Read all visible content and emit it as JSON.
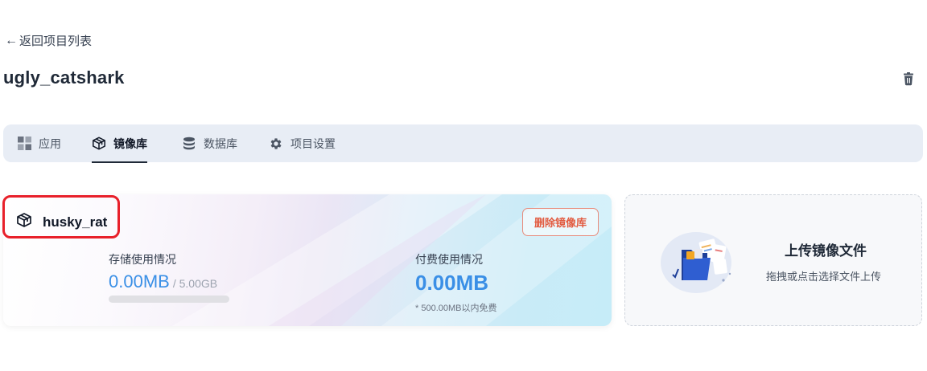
{
  "nav": {
    "back_label": "返回项目列表",
    "back_icon": "arrow-left-icon"
  },
  "project": {
    "title": "ugly_catshark",
    "delete_icon": "trash-icon"
  },
  "tabs": [
    {
      "label": "应用",
      "icon": "grid-icon",
      "active": false
    },
    {
      "label": "镜像库",
      "icon": "cube-icon",
      "active": true
    },
    {
      "label": "数据库",
      "icon": "database-icon",
      "active": false
    },
    {
      "label": "项目设置",
      "icon": "gear-icon",
      "active": false
    }
  ],
  "repository": {
    "name": "husky_rat",
    "icon": "cube-icon",
    "delete_label": "删除镜像库",
    "storage": {
      "label": "存储使用情况",
      "used": "0.00MB",
      "total": "/ 5.00GB",
      "usage_fraction": 0
    },
    "paid": {
      "label": "付费使用情况",
      "value": "0.00MB",
      "note": "* 500.00MB以内免费"
    }
  },
  "upload": {
    "title": "上传镜像文件",
    "subtitle": "拖拽或点击选择文件上传",
    "icon": "folder-upload-illustration"
  },
  "colors": {
    "accent": "#3a8fe6",
    "danger": "#e25b40",
    "highlight_box": "#e8202a",
    "tabbar_bg": "#e8edf5"
  }
}
